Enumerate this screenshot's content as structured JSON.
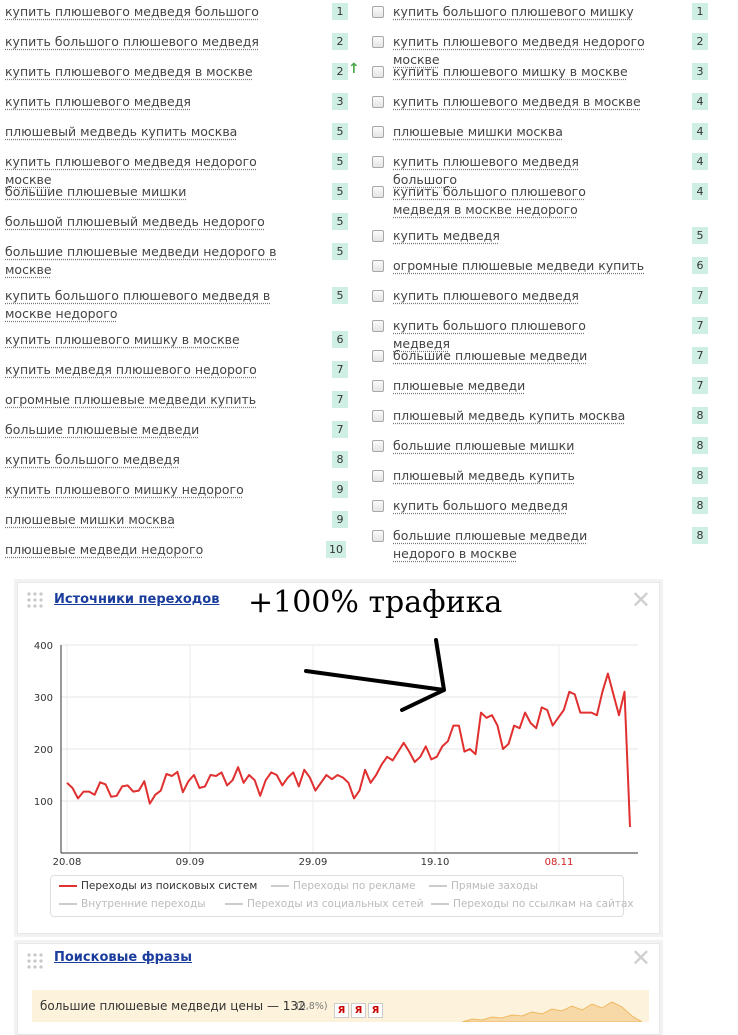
{
  "left_list": [
    {
      "text": "купить плюшевого медведя большого",
      "rank": "1"
    },
    {
      "text": "купить большого плюшевого медведя",
      "rank": "2"
    },
    {
      "text": "купить плюшевого медведя в москве",
      "rank": "2"
    },
    {
      "text": "купить плюшевого медведя",
      "rank": "3"
    },
    {
      "text": "плюшевый медведь купить москва",
      "rank": "5"
    },
    {
      "text": "купить плюшевого медведя недорого москве",
      "rank": "5"
    },
    {
      "text": "большие плюшевые мишки",
      "rank": "5"
    },
    {
      "text": "большой плюшевый медведь недорого",
      "rank": "5"
    },
    {
      "text": "большие плюшевые медведи недорого в москве",
      "rank": "5"
    },
    {
      "text": "купить большого плюшевого медведя в москве недорого",
      "rank": "5"
    },
    {
      "text": "купить плюшевого мишку в москве",
      "rank": "6"
    },
    {
      "text": "купить медведя плюшевого недорого",
      "rank": "7"
    },
    {
      "text": "огромные плюшевые медведи купить",
      "rank": "7"
    },
    {
      "text": "большие плюшевые медведи",
      "rank": "7"
    },
    {
      "text": "купить большого медведя",
      "rank": "8"
    },
    {
      "text": "купить плюшевого мишку недорого",
      "rank": "9"
    },
    {
      "text": "плюшевые мишки москва",
      "rank": "9"
    },
    {
      "text": "плюшевые медведи недорого",
      "rank": "10"
    }
  ],
  "right_list": [
    {
      "text": "купить большого плюшевого мишку",
      "rank": "1"
    },
    {
      "text": "купить плюшевого медведя недорого москве",
      "rank": "2"
    },
    {
      "text": "купить плюшевого мишку в москве",
      "rank": "3"
    },
    {
      "text": "купить плюшевого медведя в москве",
      "rank": "4"
    },
    {
      "text": "плюшевые мишки москва",
      "rank": "4"
    },
    {
      "text": "купить плюшевого медведя большого",
      "rank": "4"
    },
    {
      "text": "купить большого плюшевого медведя в москве недорого",
      "rank": "4"
    },
    {
      "text": "купить медведя",
      "rank": "5"
    },
    {
      "text": "огромные плюшевые медведи купить",
      "rank": "6"
    },
    {
      "text": "купить плюшевого медведя",
      "rank": "7"
    },
    {
      "text": "купить большого плюшевого медведя",
      "rank": "7"
    },
    {
      "text": "большие плюшевые медведи",
      "rank": "7"
    },
    {
      "text": "плюшевые медведи",
      "rank": "7"
    },
    {
      "text": "плюшевый медведь купить москва",
      "rank": "8"
    },
    {
      "text": "большие плюшевые мишки",
      "rank": "8"
    },
    {
      "text": "плюшевый медведь купить",
      "rank": "8"
    },
    {
      "text": "купить большого медведя",
      "rank": "8"
    },
    {
      "text": "большие плюшевые медведи недорого в москве",
      "rank": "8"
    }
  ],
  "trend_up_icon": "arrow-up",
  "traffic_panel": {
    "title": "Источники переходов",
    "overlay": "+100% трафика",
    "legend": [
      {
        "label": "Переходы из поисковых систем",
        "active": true
      },
      {
        "label": "Переходы по рекламе",
        "active": false
      },
      {
        "label": "Прямые заходы",
        "active": false
      },
      {
        "label": "Внутренние переходы",
        "active": false
      },
      {
        "label": "Переходы из социальных сетей",
        "active": false
      },
      {
        "label": "Переходы по ссылкам на сайтах",
        "active": false
      }
    ]
  },
  "chart_data": {
    "type": "line",
    "y_ticks": [
      "400",
      "300",
      "200",
      "100"
    ],
    "ylim": [
      0,
      400
    ],
    "x_ticks": [
      "20.08",
      "09.09",
      "29.09",
      "19.10",
      "08.11"
    ],
    "highlight_tick": "08.11",
    "series": [
      {
        "name": "Переходы из поисковых систем",
        "color": "#e03030",
        "values": [
          135,
          125,
          105,
          118,
          118,
          112,
          136,
          132,
          108,
          110,
          128,
          130,
          118,
          120,
          138,
          95,
          112,
          120,
          152,
          148,
          156,
          117,
          138,
          150,
          125,
          128,
          150,
          148,
          155,
          130,
          140,
          165,
          135,
          150,
          140,
          110,
          140,
          155,
          150,
          130,
          145,
          155,
          128,
          160,
          145,
          120,
          135,
          150,
          142,
          150,
          145,
          135,
          105,
          120,
          160,
          135,
          150,
          170,
          185,
          178,
          195,
          212,
          195,
          175,
          185,
          205,
          180,
          185,
          205,
          215,
          245,
          245,
          195,
          200,
          190,
          270,
          260,
          265,
          245,
          200,
          210,
          245,
          240,
          270,
          250,
          240,
          280,
          275,
          245,
          260,
          275,
          310,
          305,
          270,
          270,
          270,
          265,
          310,
          345,
          305,
          265,
          310,
          50
        ]
      }
    ]
  },
  "phrases_panel": {
    "title": "Поисковые фразы",
    "row_text": "большие плюшевые медведи цены — 132",
    "row_pct": "(0,8%)",
    "y_tags": [
      "Я",
      "Я",
      "Я"
    ]
  }
}
